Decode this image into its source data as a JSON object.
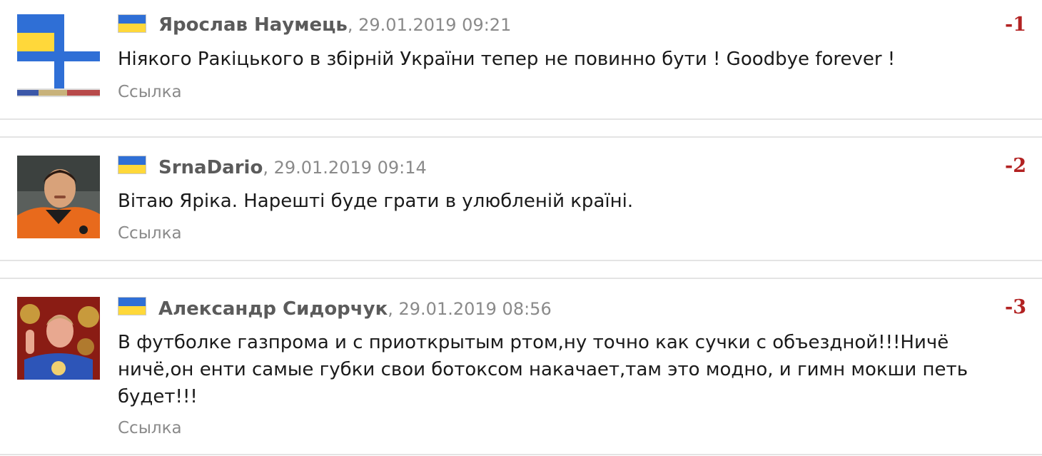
{
  "comments": [
    {
      "author": "Ярослав Наумець",
      "date": "29.01.2019 09:21",
      "text": "Ніякого Ракіцького в збірній України тепер не повинно бути ! Goodbye forever !",
      "link": "Ссылка",
      "rating": "-1",
      "avatar_icon": "navy-ensign-avatar",
      "flag_icon": "ukraine-flag-icon"
    },
    {
      "author": "SrnaDario",
      "date": "29.01.2019 09:14",
      "text": "Вітаю Яріка. Нарешті буде грати в улюбленій країні.",
      "link": "Ссылка",
      "rating": "-2",
      "avatar_icon": "player-photo-avatar",
      "flag_icon": "ukraine-flag-icon"
    },
    {
      "author": "Александр Сидорчук",
      "date": "29.01.2019 08:56",
      "text": "В футболке газпрома и с приоткрытым ртом,ну точно как сучки с объездной!!!Ничё ничё,он енти самые губки свои ботоксом накачает,там это модно, и гимн мокши петь будет!!!",
      "link": "Ссылка",
      "rating": "-3",
      "avatar_icon": "user-photo-avatar",
      "flag_icon": "ukraine-flag-icon"
    }
  ],
  "colors": {
    "author": "#5b5b5b",
    "date": "#8a8a8a",
    "rating": "#b22222",
    "flag_blue": "#2f6fd6",
    "flag_yellow": "#ffd83a",
    "separator": "#e4e4e4"
  }
}
